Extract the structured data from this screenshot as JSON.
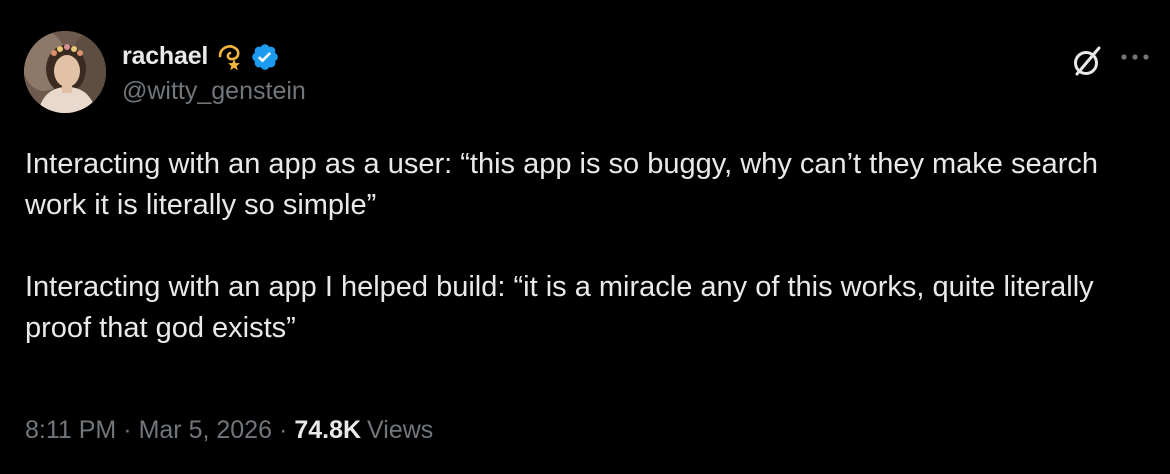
{
  "author": {
    "display_name": "rachael",
    "handle": "@witty_genstein",
    "name_emoji": "dizzy-star-emoji",
    "verified": true,
    "verified_color": "#1d9bf0",
    "avatar": "profile-photo"
  },
  "actions": {
    "grok_icon": "grok-slash-icon",
    "more_icon": "more-horizontal-icon"
  },
  "tweet": {
    "paragraphs": [
      "Interacting with an app as a user: “this app is so buggy, why can’t they make search work it is literally so simple”",
      "Interacting with an app I helped build: “it is a miracle any of this works, quite literally proof that god exists”"
    ]
  },
  "meta": {
    "time": "8:11 PM",
    "separator": "·",
    "date": "Mar 5, 2026",
    "views_count": "74.8K",
    "views_label": "Views"
  },
  "colors": {
    "background": "#000000",
    "text_primary": "#e7e9ea",
    "text_secondary": "#71767b",
    "accent_blue": "#1d9bf0"
  }
}
